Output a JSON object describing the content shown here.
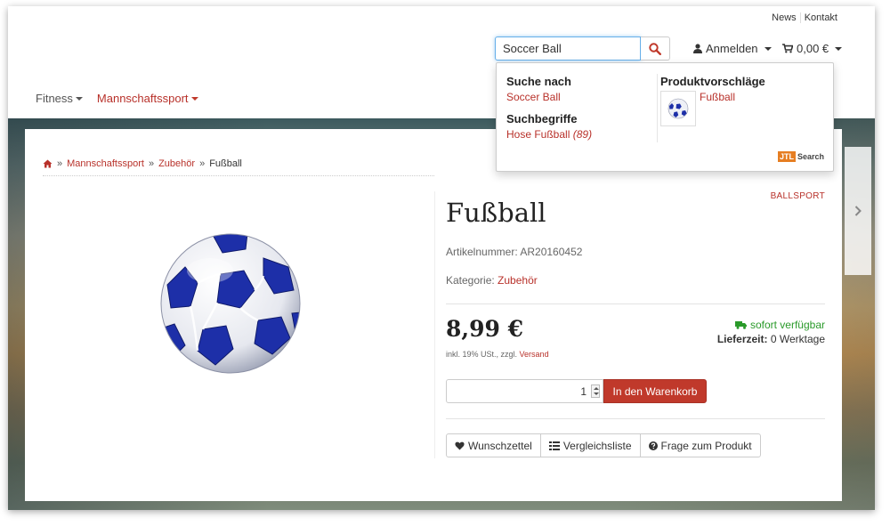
{
  "header": {
    "top_links": [
      "News",
      "Kontakt"
    ],
    "search": {
      "value": "Soccer Ball"
    },
    "login_label": "Anmelden",
    "cart_label": "0,00 €"
  },
  "nav": {
    "items": [
      {
        "label": "Fitness"
      },
      {
        "label": "Mannschaftssport"
      }
    ]
  },
  "search_dropdown": {
    "suche_nach_heading": "Suche nach",
    "suche_nach_value": "Soccer Ball",
    "suchbegriffe_heading": "Suchbegriffe",
    "suchbegriffe_term": "Hose Fußball",
    "suchbegriffe_count": "(89)",
    "produktvorschlaege_heading": "Produktvorschläge",
    "suggestion_label": "Fußball",
    "badge_box": "JTL",
    "badge_text": "Search"
  },
  "breadcrumb": {
    "items": [
      "Mannschaftssport",
      "Zubehör",
      "Fußball"
    ],
    "separator": "»"
  },
  "product": {
    "brand": "BALLSPORT",
    "title": "Fußball",
    "artnr": "Artikelnummer: AR20160452",
    "category_label": "Kategorie:",
    "category_value": "Zubehör",
    "price": "8,99 €",
    "vat_text": "inkl. 19% USt., zzgl.",
    "shipping_link": "Versand",
    "availability": "sofort verfügbar",
    "delivery_label": "Lieferzeit:",
    "delivery_value": "0 Werktage",
    "quantity": "1",
    "add_to_cart": "In den Warenkorb",
    "actions": [
      "Wunschzettel",
      "Vergleichsliste",
      "Frage zum Produkt"
    ]
  },
  "colors": {
    "accent": "#b8312a",
    "button": "#c0392b",
    "available": "#2a9a2a",
    "ball_blue": "#1d2fa8"
  },
  "icons": [
    "user-icon",
    "cart-icon",
    "search-icon",
    "home-icon",
    "truck-icon",
    "heart-icon",
    "list-icon",
    "question-icon",
    "chevron-right-icon"
  ]
}
